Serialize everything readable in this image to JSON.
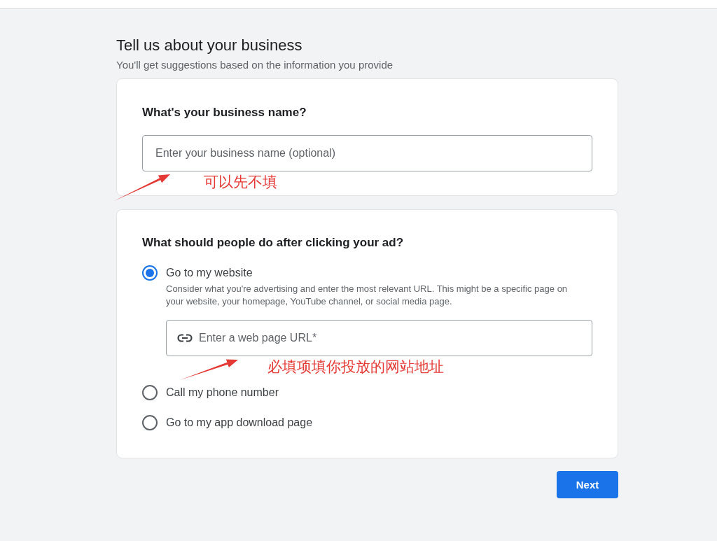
{
  "header": {
    "title": "Tell us about your business",
    "subtitle": "You'll get suggestions based on the information you provide"
  },
  "business_name": {
    "question": "What's your business name?",
    "field": {
      "placeholder": "Enter your business name (optional)"
    },
    "annotation": "可以先不填"
  },
  "ad_action": {
    "question": "What should people do after clicking your ad?",
    "options": [
      {
        "label": "Go to my website",
        "selected": true,
        "description": "Consider what you're advertising and enter the most relevant URL. This might be a specific page on your website, your homepage, YouTube channel, or social media page.",
        "field": {
          "placeholder": "Enter a web page URL*"
        },
        "annotation": "必填项填你投放的网站地址"
      },
      {
        "label": "Call my phone number",
        "selected": false
      },
      {
        "label": "Go to my app download page",
        "selected": false
      }
    ]
  },
  "next_button": {
    "label": "Next"
  }
}
